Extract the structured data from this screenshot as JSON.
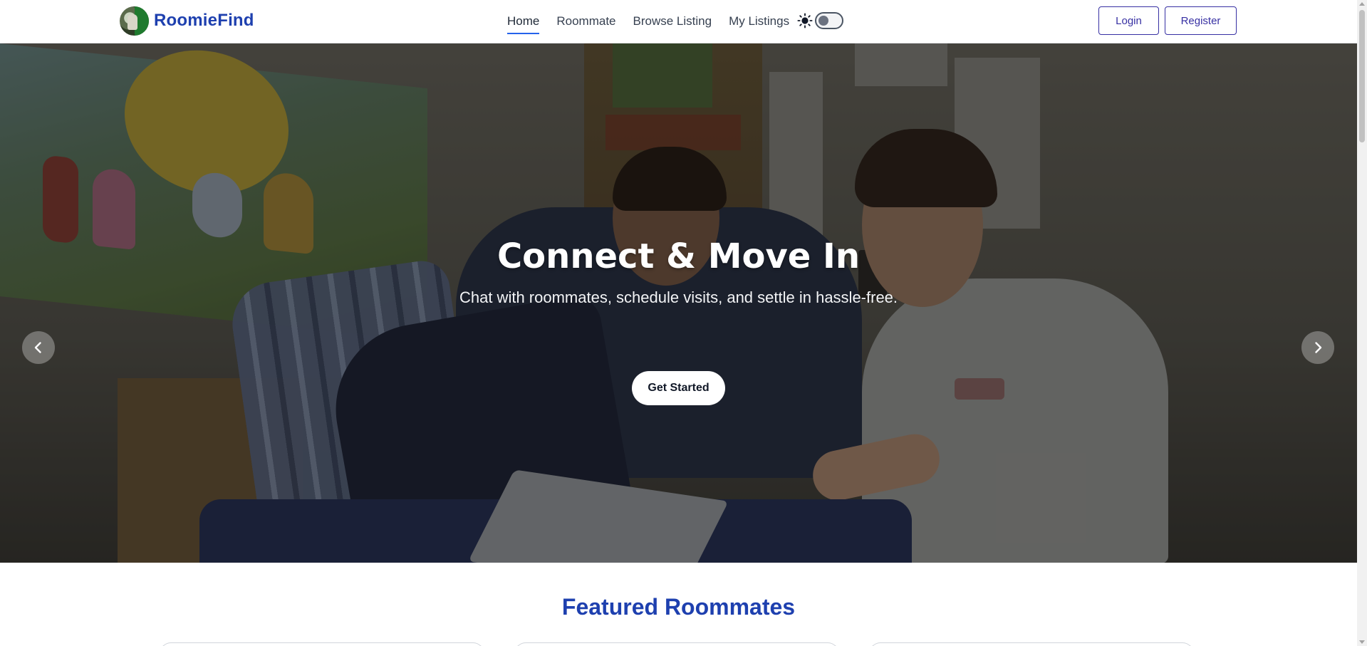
{
  "brand": {
    "name": "RoomieFind",
    "logo_icon": "roomiefind-logo-icon"
  },
  "nav": {
    "items": [
      {
        "label": "Home",
        "active": true
      },
      {
        "label": "Roommate",
        "active": false
      },
      {
        "label": "Browse Listing",
        "active": false
      },
      {
        "label": "My Listings",
        "active": false
      }
    ],
    "theme_toggle": {
      "icon": "sun-icon",
      "dark_mode": false
    }
  },
  "auth": {
    "login_label": "Login",
    "register_label": "Register"
  },
  "hero": {
    "title": "Connect & Move In",
    "subtitle": "Chat with roommates, schedule visits, and settle in hassle-free.",
    "cta_label": "Get Started",
    "prev_icon": "chevron-left-icon",
    "next_icon": "chevron-right-icon"
  },
  "featured": {
    "title": "Featured Roommates"
  },
  "colors": {
    "brand": "#1e40af",
    "accent": "#2563eb",
    "button_outline": "#3730a3"
  }
}
